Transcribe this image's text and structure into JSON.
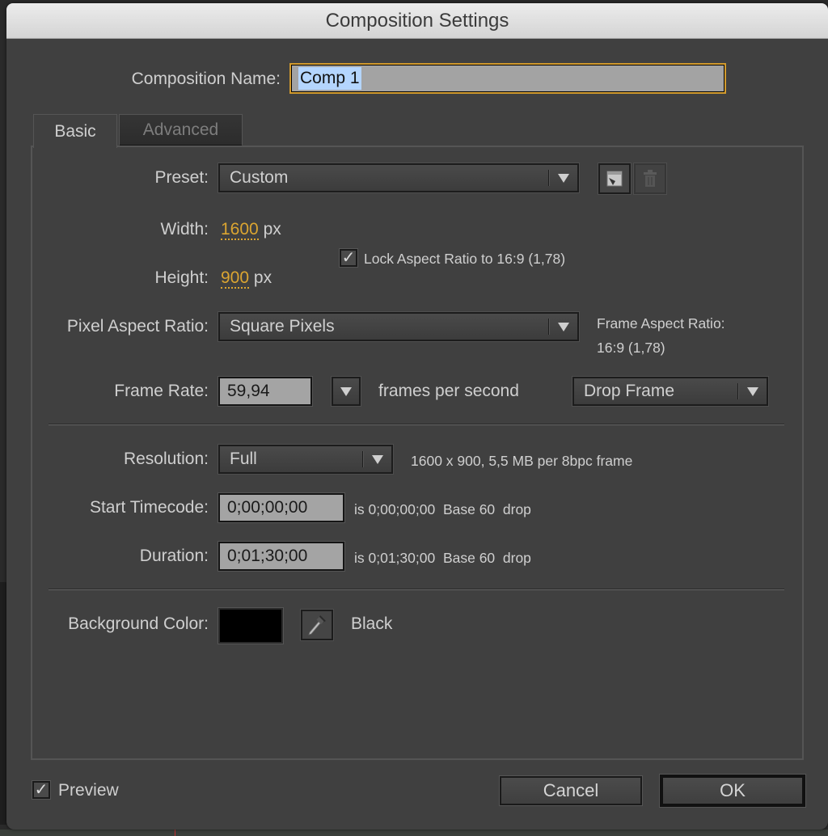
{
  "window": {
    "title": "Composition Settings"
  },
  "composition_name": {
    "label": "Composition Name:",
    "value": "Comp 1"
  },
  "tabs": [
    {
      "label": "Basic",
      "active": true
    },
    {
      "label": "Advanced",
      "active": false
    }
  ],
  "preset": {
    "label": "Preset:",
    "value": "Custom",
    "save_icon": "save-preset-icon",
    "delete_icon": "trash-icon"
  },
  "width": {
    "label": "Width:",
    "value": "1600",
    "unit": "px"
  },
  "height": {
    "label": "Height:",
    "value": "900",
    "unit": "px"
  },
  "lock_aspect": {
    "checked": true,
    "label": "Lock Aspect Ratio to 16:9 (1,78)"
  },
  "pixel_aspect": {
    "label": "Pixel Aspect Ratio:",
    "value": "Square Pixels",
    "frame_aspect_label": "Frame Aspect Ratio:",
    "frame_aspect_value": "16:9 (1,78)"
  },
  "frame_rate": {
    "label": "Frame Rate:",
    "value": "59,94",
    "unit_label": "frames per second",
    "drop_mode": "Drop Frame"
  },
  "resolution": {
    "label": "Resolution:",
    "value": "Full",
    "info": "1600 x 900, 5,5 MB per 8bpc frame"
  },
  "start_timecode": {
    "label": "Start Timecode:",
    "value": "0;00;00;00",
    "info": "is 0;00;00;00  Base 60  drop"
  },
  "duration": {
    "label": "Duration:",
    "value": "0;01;30;00",
    "info": "is 0;01;30;00  Base 60  drop"
  },
  "background_color": {
    "label": "Background Color:",
    "color": "#000000",
    "name": "Black",
    "eyedropper_icon": "eyedropper-icon"
  },
  "footer": {
    "preview_label": "Preview",
    "preview_checked": true,
    "cancel_label": "Cancel",
    "ok_label": "OK"
  },
  "colors": {
    "accent_hot_text": "#dba531",
    "focus_ring": "#d19a2e",
    "selection": "#b4d5fe",
    "panel_bg": "#404040"
  }
}
